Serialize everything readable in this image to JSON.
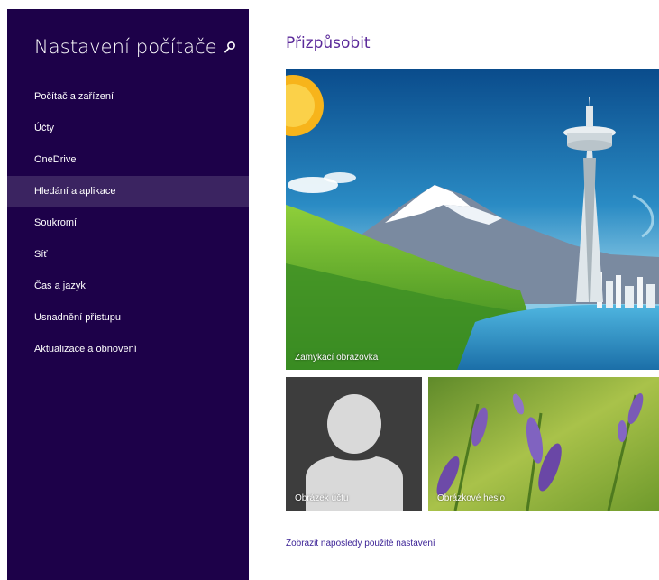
{
  "sidebar": {
    "title": "Nastavení počítače",
    "search_icon": "search-icon",
    "items": [
      {
        "label": "Počítač a zařízení"
      },
      {
        "label": "Účty"
      },
      {
        "label": "OneDrive"
      },
      {
        "label": "Hledání a aplikace"
      },
      {
        "label": "Soukromí"
      },
      {
        "label": "Síť"
      },
      {
        "label": "Čas a jazyk"
      },
      {
        "label": "Usnadnění přístupu"
      },
      {
        "label": "Aktualizace a obnovení"
      }
    ],
    "active_index": 3
  },
  "main": {
    "title": "Přizpůsobit",
    "tiles": {
      "lock_screen": "Zamykací obrazovka",
      "account_picture": "Obrázek účtu",
      "picture_password": "Obrázkové heslo"
    },
    "recent_link": "Zobrazit naposledy použité nastavení"
  },
  "colors": {
    "sidebar_bg": "#1d0149",
    "sidebar_active": "#3b2461",
    "accent_title": "#5b2a9a",
    "link": "#3c2396"
  }
}
